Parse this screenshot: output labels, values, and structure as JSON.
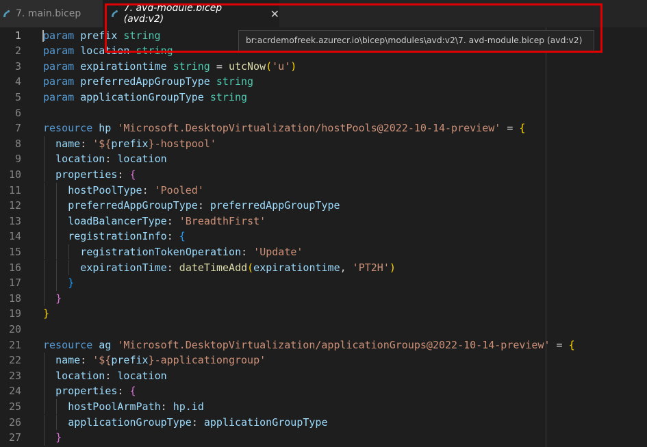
{
  "tabs": [
    {
      "label": "7. main.bicep",
      "active": false
    },
    {
      "label": "7. avd-module.bicep (avd:v2)",
      "active": true
    }
  ],
  "close_glyph": "✕",
  "tooltip": "br:acrdemofreek.azurecr.io\\bicep\\modules\\avd:v2\\7. avd-module.bicep (avd:v2)",
  "highlight_color": "#e00000",
  "icons": {
    "tab_file": "bicep-file-icon",
    "close": "close-icon"
  },
  "editor": {
    "current_line": 1,
    "lines": [
      {
        "n": "1",
        "indent": 0,
        "tokens": [
          [
            "kw",
            "param"
          ],
          [
            "op",
            " "
          ],
          [
            "id",
            "prefix"
          ],
          [
            "op",
            " "
          ],
          [
            "ty",
            "string"
          ]
        ]
      },
      {
        "n": "2",
        "indent": 0,
        "tokens": [
          [
            "kw",
            "param"
          ],
          [
            "op",
            " "
          ],
          [
            "id",
            "location"
          ],
          [
            "op",
            " "
          ],
          [
            "ty",
            "string"
          ]
        ]
      },
      {
        "n": "3",
        "indent": 0,
        "tokens": [
          [
            "kw",
            "param"
          ],
          [
            "op",
            " "
          ],
          [
            "id",
            "expirationtime"
          ],
          [
            "op",
            " "
          ],
          [
            "ty",
            "string"
          ],
          [
            "op",
            " = "
          ],
          [
            "fn",
            "utcNow"
          ],
          [
            "b1",
            "("
          ],
          [
            "st",
            "'u'"
          ],
          [
            "b1",
            ")"
          ]
        ]
      },
      {
        "n": "4",
        "indent": 0,
        "tokens": [
          [
            "kw",
            "param"
          ],
          [
            "op",
            " "
          ],
          [
            "id",
            "preferredAppGroupType"
          ],
          [
            "op",
            " "
          ],
          [
            "ty",
            "string"
          ]
        ]
      },
      {
        "n": "5",
        "indent": 0,
        "tokens": [
          [
            "kw",
            "param"
          ],
          [
            "op",
            " "
          ],
          [
            "id",
            "applicationGroupType"
          ],
          [
            "op",
            " "
          ],
          [
            "ty",
            "string"
          ]
        ]
      },
      {
        "n": "6",
        "indent": 0,
        "tokens": []
      },
      {
        "n": "7",
        "indent": 0,
        "tokens": [
          [
            "kw",
            "resource"
          ],
          [
            "op",
            " "
          ],
          [
            "id",
            "hp"
          ],
          [
            "op",
            " "
          ],
          [
            "st",
            "'Microsoft.DesktopVirtualization/hostPools@2022-10-14-preview'"
          ],
          [
            "op",
            " = "
          ],
          [
            "b1",
            "{"
          ]
        ]
      },
      {
        "n": "8",
        "indent": 1,
        "tokens": [
          [
            "id",
            "name"
          ],
          [
            "op",
            ": "
          ],
          [
            "st",
            "'${"
          ],
          [
            "id",
            "prefix"
          ],
          [
            "st",
            "}-hostpool'"
          ]
        ]
      },
      {
        "n": "9",
        "indent": 1,
        "tokens": [
          [
            "id",
            "location"
          ],
          [
            "op",
            ": "
          ],
          [
            "id",
            "location"
          ]
        ]
      },
      {
        "n": "10",
        "indent": 1,
        "tokens": [
          [
            "id",
            "properties"
          ],
          [
            "op",
            ": "
          ],
          [
            "b2",
            "{"
          ]
        ]
      },
      {
        "n": "11",
        "indent": 2,
        "tokens": [
          [
            "id",
            "hostPoolType"
          ],
          [
            "op",
            ": "
          ],
          [
            "st",
            "'Pooled'"
          ]
        ]
      },
      {
        "n": "12",
        "indent": 2,
        "tokens": [
          [
            "id",
            "preferredAppGroupType"
          ],
          [
            "op",
            ": "
          ],
          [
            "id",
            "preferredAppGroupType"
          ]
        ]
      },
      {
        "n": "13",
        "indent": 2,
        "tokens": [
          [
            "id",
            "loadBalancerType"
          ],
          [
            "op",
            ": "
          ],
          [
            "st",
            "'BreadthFirst'"
          ]
        ]
      },
      {
        "n": "14",
        "indent": 2,
        "tokens": [
          [
            "id",
            "registrationInfo"
          ],
          [
            "op",
            ": "
          ],
          [
            "b3",
            "{"
          ]
        ]
      },
      {
        "n": "15",
        "indent": 3,
        "tokens": [
          [
            "id",
            "registrationTokenOperation"
          ],
          [
            "op",
            ": "
          ],
          [
            "st",
            "'Update'"
          ]
        ]
      },
      {
        "n": "16",
        "indent": 3,
        "tokens": [
          [
            "id",
            "expirationTime"
          ],
          [
            "op",
            ": "
          ],
          [
            "fn",
            "dateTimeAdd"
          ],
          [
            "b1",
            "("
          ],
          [
            "id",
            "expirationtime"
          ],
          [
            "op",
            ", "
          ],
          [
            "st",
            "'PT2H'"
          ],
          [
            "b1",
            ")"
          ]
        ]
      },
      {
        "n": "17",
        "indent": 2,
        "tokens": [
          [
            "b3",
            "}"
          ]
        ]
      },
      {
        "n": "18",
        "indent": 1,
        "tokens": [
          [
            "b2",
            "}"
          ]
        ]
      },
      {
        "n": "19",
        "indent": 0,
        "tokens": [
          [
            "b1",
            "}"
          ]
        ]
      },
      {
        "n": "20",
        "indent": 0,
        "tokens": []
      },
      {
        "n": "21",
        "indent": 0,
        "tokens": [
          [
            "kw",
            "resource"
          ],
          [
            "op",
            " "
          ],
          [
            "id",
            "ag"
          ],
          [
            "op",
            " "
          ],
          [
            "st",
            "'Microsoft.DesktopVirtualization/applicationGroups@2022-10-14-preview'"
          ],
          [
            "op",
            " = "
          ],
          [
            "b1",
            "{"
          ]
        ]
      },
      {
        "n": "22",
        "indent": 1,
        "tokens": [
          [
            "id",
            "name"
          ],
          [
            "op",
            ": "
          ],
          [
            "st",
            "'${"
          ],
          [
            "id",
            "prefix"
          ],
          [
            "st",
            "}-applicationgroup'"
          ]
        ]
      },
      {
        "n": "23",
        "indent": 1,
        "tokens": [
          [
            "id",
            "location"
          ],
          [
            "op",
            ": "
          ],
          [
            "id",
            "location"
          ]
        ]
      },
      {
        "n": "24",
        "indent": 1,
        "tokens": [
          [
            "id",
            "properties"
          ],
          [
            "op",
            ": "
          ],
          [
            "b2",
            "{"
          ]
        ]
      },
      {
        "n": "25",
        "indent": 2,
        "tokens": [
          [
            "id",
            "hostPoolArmPath"
          ],
          [
            "op",
            ": "
          ],
          [
            "id",
            "hp.id"
          ]
        ]
      },
      {
        "n": "26",
        "indent": 2,
        "tokens": [
          [
            "id",
            "applicationGroupType"
          ],
          [
            "op",
            ": "
          ],
          [
            "id",
            "applicationGroupType"
          ]
        ]
      },
      {
        "n": "27",
        "indent": 1,
        "tokens": [
          [
            "b2",
            "}"
          ]
        ]
      }
    ]
  }
}
